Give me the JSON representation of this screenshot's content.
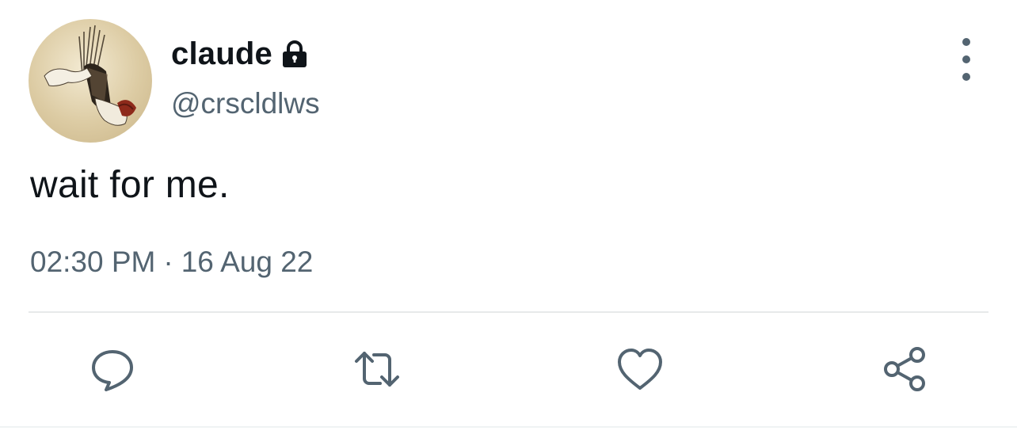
{
  "user": {
    "display_name": "claude",
    "handle": "@crscldlws",
    "protected_icon": "lock-icon",
    "avatar": "avatar-image"
  },
  "tweet": {
    "text": "wait for me.",
    "time": "02:30 PM",
    "separator": "·",
    "date": "16 Aug 22"
  },
  "actions": {
    "reply": "reply-icon",
    "retweet": "retweet-icon",
    "like": "heart-icon",
    "share": "share-icon",
    "more": "more-vertical-icon"
  },
  "colors": {
    "text": "#0f1419",
    "secondary": "#536471",
    "divider": "#e7e9ea"
  }
}
